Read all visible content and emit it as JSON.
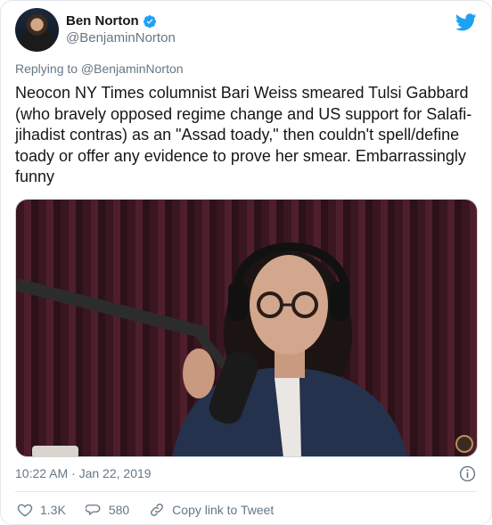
{
  "author": {
    "display_name": "Ben Norton",
    "handle": "@BenjaminNorton"
  },
  "icons": {
    "verified": "verified-badge-icon",
    "brand": "twitter-bird-icon",
    "info": "info-icon",
    "like": "heart-icon",
    "reply": "speech-bubble-icon",
    "share": "link-icon"
  },
  "colors": {
    "brand": "#1da1f2",
    "secondary_text": "#657786",
    "border": "#e1e8ed"
  },
  "reply_context": "Replying to @BenjaminNorton",
  "tweet_text": "Neocon NY Times columnist Bari Weiss smeared Tulsi Gabbard (who bravely opposed regime change and US support for Salafi-jihadist contras) as an \"Assad toady,\" then couldn't spell/define toady or offer any evidence to prove her smear. Embarrassingly funny",
  "timestamp": "10:22 AM · Jan 22, 2019",
  "actions": {
    "likes": "1.3K",
    "replies": "580",
    "copy_link": "Copy link to Tweet"
  }
}
